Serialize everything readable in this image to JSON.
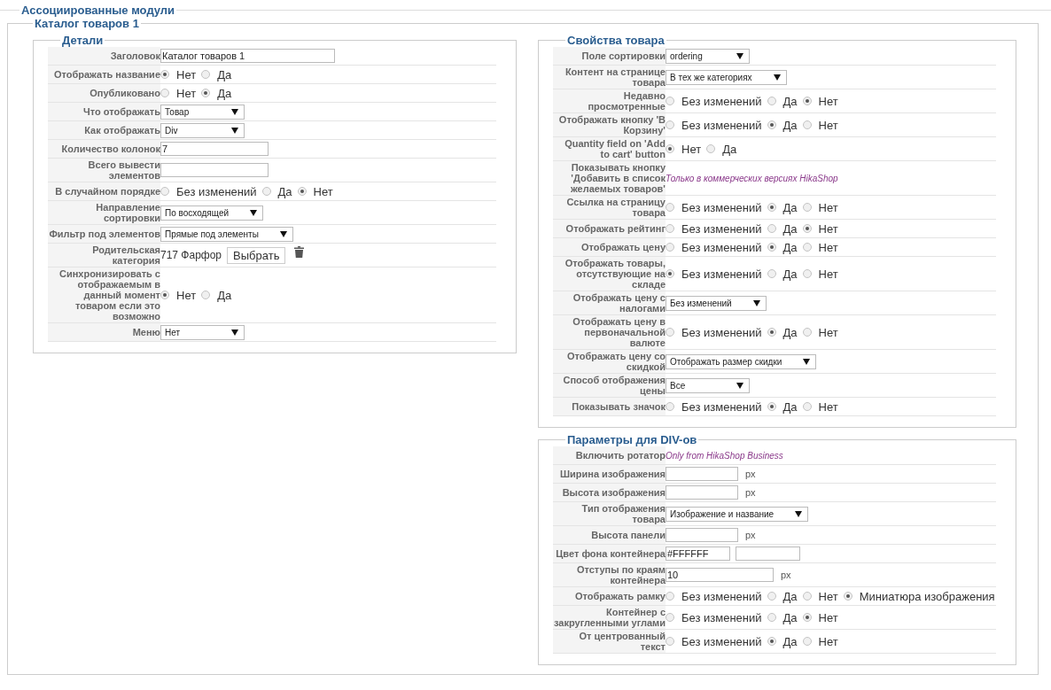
{
  "section": {
    "title": "Ассоциированные модули"
  },
  "module": {
    "title": "Каталог товаров 1"
  },
  "columns": [
    {
      "panels": [
        {
          "title": "Детали",
          "rows": [
            {
              "label": "Заголовок",
              "kind": "text",
              "value": "Каталог товаров 1"
            },
            {
              "label": "Отображать название",
              "kind": "radio",
              "options": [
                {
                  "label": "Нет",
                  "selected": true
                },
                {
                  "label": "Да",
                  "selected": false
                }
              ]
            },
            {
              "label": "Опубликовано",
              "kind": "radio",
              "options": [
                {
                  "label": "Нет",
                  "selected": false
                },
                {
                  "label": "Да",
                  "selected": true
                }
              ]
            },
            {
              "label": "Что отображать",
              "kind": "select",
              "value": "Товар"
            },
            {
              "label": "Как отображать",
              "kind": "select",
              "value": "Div"
            },
            {
              "label": "Количество колонок",
              "kind": "text",
              "value": "7"
            },
            {
              "label": "Всего вывести элементов",
              "kind": "text"
            },
            {
              "label": "В случайном порядке",
              "kind": "radio",
              "options": [
                {
                  "label": "Без изменений",
                  "selected": false
                },
                {
                  "label": "Да",
                  "selected": false
                },
                {
                  "label": "Нет",
                  "selected": true
                }
              ]
            },
            {
              "label": "Направление сортировки",
              "kind": "select",
              "value": "По восходящей"
            },
            {
              "label": "Фильтр под элементов",
              "kind": "select",
              "value": "Прямые под элементы"
            },
            {
              "label": "Родительская категория",
              "kind": "category",
              "value": "717 Фарфор",
              "button": "Выбрать"
            },
            {
              "label": "Синхронизировать с отображаемым в данный момент товаром если это возможно",
              "kind": "radio",
              "options": [
                {
                  "label": "Нет",
                  "selected": true
                },
                {
                  "label": "Да",
                  "selected": false
                }
              ]
            },
            {
              "label": "Меню",
              "kind": "select",
              "value": "Нет"
            }
          ]
        }
      ]
    },
    {
      "panels": [
        {
          "title": "Свойства товара",
          "rows": [
            {
              "label": "Поле сортировки",
              "kind": "select",
              "value": "ordering"
            },
            {
              "label": "Контент на странице товара",
              "kind": "select",
              "value": "В тех же категориях"
            },
            {
              "label": "Недавно просмотренные",
              "kind": "radio",
              "options": [
                {
                  "label": "Без изменений",
                  "selected": false
                },
                {
                  "label": "Да",
                  "selected": false
                },
                {
                  "label": "Нет",
                  "selected": true
                }
              ]
            },
            {
              "label": "Отображать кнопку 'В Корзину'",
              "kind": "radio",
              "options": [
                {
                  "label": "Без изменений",
                  "selected": false
                },
                {
                  "label": "Да",
                  "selected": true
                },
                {
                  "label": "Нет",
                  "selected": false
                }
              ]
            },
            {
              "label": "Quantity field on 'Add to cart' button",
              "kind": "radio",
              "options": [
                {
                  "label": "Нет",
                  "selected": true
                },
                {
                  "label": "Да",
                  "selected": false
                }
              ]
            },
            {
              "label": "Показывать кнопку 'Добавить в список желаемых товаров'",
              "kind": "note",
              "value": "Только в коммерческих версиях HikaShop"
            },
            {
              "label": "Ссылка на страницу товара",
              "kind": "radio",
              "options": [
                {
                  "label": "Без изменений",
                  "selected": false
                },
                {
                  "label": "Да",
                  "selected": true
                },
                {
                  "label": "Нет",
                  "selected": false
                }
              ]
            },
            {
              "label": "Отображать рейтинг",
              "kind": "radio",
              "options": [
                {
                  "label": "Без изменений",
                  "selected": false
                },
                {
                  "label": "Да",
                  "selected": false
                },
                {
                  "label": "Нет",
                  "selected": true
                }
              ]
            },
            {
              "label": "Отображать цену",
              "kind": "radio",
              "options": [
                {
                  "label": "Без изменений",
                  "selected": false
                },
                {
                  "label": "Да",
                  "selected": true
                },
                {
                  "label": "Нет",
                  "selected": false
                }
              ]
            },
            {
              "label": "Отображать товары, отсутствующие на складе",
              "kind": "radio",
              "options": [
                {
                  "label": "Без изменений",
                  "selected": true
                },
                {
                  "label": "Да",
                  "selected": false
                },
                {
                  "label": "Нет",
                  "selected": false
                }
              ]
            },
            {
              "label": "Отображать цену с налогами",
              "kind": "select",
              "value": "Без изменений"
            },
            {
              "label": "Отображать цену в первоначальной валюте",
              "kind": "radio",
              "options": [
                {
                  "label": "Без изменений",
                  "selected": false
                },
                {
                  "label": "Да",
                  "selected": true
                },
                {
                  "label": "Нет",
                  "selected": false
                }
              ]
            },
            {
              "label": "Отображать цену со скидкой",
              "kind": "select",
              "value": "Отображать размер скидки"
            },
            {
              "label": "Способ отображения цены",
              "kind": "select",
              "value": "Все"
            },
            {
              "label": "Показывать значок",
              "kind": "radio",
              "options": [
                {
                  "label": "Без изменений",
                  "selected": false
                },
                {
                  "label": "Да",
                  "selected": true
                },
                {
                  "label": "Нет",
                  "selected": false
                }
              ]
            }
          ]
        },
        {
          "title": "Параметры для DIV-ов",
          "rows": [
            {
              "label": "Включить ротатор",
              "kind": "note",
              "value": "Only from HikaShop Business"
            },
            {
              "label": "Ширина изображения",
              "kind": "text",
              "unit": "px"
            },
            {
              "label": "Высота изображения",
              "kind": "text",
              "unit": "px"
            },
            {
              "label": "Тип отображения товара",
              "kind": "select",
              "value": "Изображение и название"
            },
            {
              "label": "Высота панели",
              "kind": "text",
              "unit": "px"
            },
            {
              "label": "Цвет фона контейнера",
              "kind": "color",
              "value": "#FFFFFF"
            },
            {
              "label": "Отступы по краям контейнера",
              "kind": "text",
              "value": "10",
              "unit": "px"
            },
            {
              "label": "Отображать рамку",
              "kind": "radio",
              "options": [
                {
                  "label": "Без изменений",
                  "selected": false
                },
                {
                  "label": "Да",
                  "selected": false
                },
                {
                  "label": "Нет",
                  "selected": false
                },
                {
                  "label": "Миниатюра изображения",
                  "selected": true
                }
              ]
            },
            {
              "label": "Контейнер с закругленными углами",
              "kind": "radio",
              "options": [
                {
                  "label": "Без изменений",
                  "selected": false
                },
                {
                  "label": "Да",
                  "selected": false
                },
                {
                  "label": "Нет",
                  "selected": true
                }
              ]
            },
            {
              "label": "От центрованный текст",
              "kind": "radio",
              "options": [
                {
                  "label": "Без изменений",
                  "selected": false
                },
                {
                  "label": "Да",
                  "selected": true
                },
                {
                  "label": "Нет",
                  "selected": false
                }
              ]
            }
          ]
        }
      ]
    }
  ]
}
